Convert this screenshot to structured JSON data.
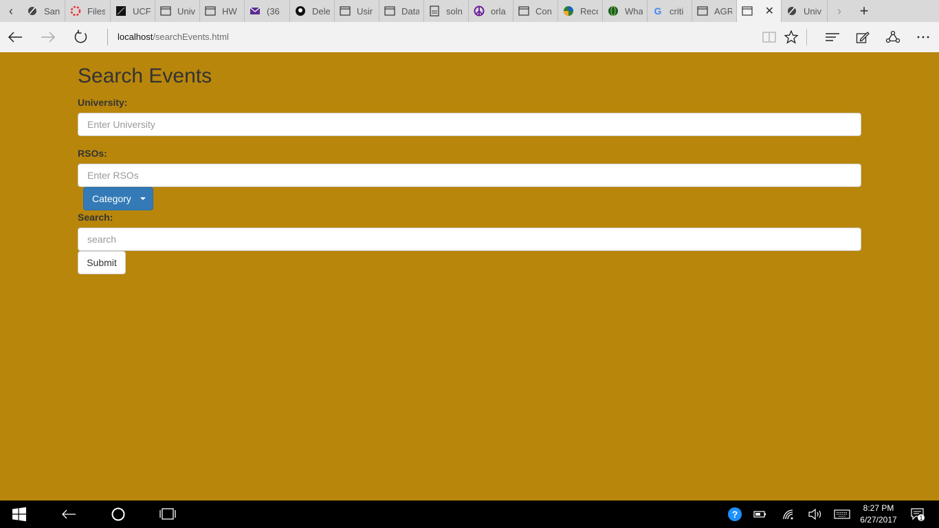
{
  "tabs": [
    {
      "label": "San",
      "icon": "unicorn-icon"
    },
    {
      "label": "Files",
      "icon": "lifering-icon"
    },
    {
      "label": "UCF",
      "icon": "ucf-icon"
    },
    {
      "label": "Univ",
      "icon": "page-icon"
    },
    {
      "label": "HW",
      "icon": "page-icon"
    },
    {
      "label": "(36",
      "icon": "mail-icon"
    },
    {
      "label": "Dele",
      "icon": "github-icon"
    },
    {
      "label": "Usir",
      "icon": "page-icon"
    },
    {
      "label": "Data",
      "icon": "page-icon"
    },
    {
      "label": "soln",
      "icon": "pdf-icon"
    },
    {
      "label": "orla",
      "icon": "peace-icon"
    },
    {
      "label": "Con",
      "icon": "page-icon"
    },
    {
      "label": "Reco",
      "icon": "globe-color-icon"
    },
    {
      "label": "Wha",
      "icon": "globe-icon"
    },
    {
      "label": "criti",
      "icon": "google-icon"
    },
    {
      "label": "AGR",
      "icon": "page-icon"
    },
    {
      "label": "",
      "icon": "page-icon",
      "active": true
    },
    {
      "label": "Univ",
      "icon": "unicorn-icon"
    }
  ],
  "address": {
    "host": "localhost",
    "path": "/searchEvents.html"
  },
  "page": {
    "title": "Search Events",
    "university_label": "University:",
    "university_placeholder": "Enter University",
    "rsos_label": "RSOs:",
    "rsos_placeholder": "Enter RSOs",
    "category_label": "Category",
    "search_label": "Search:",
    "search_placeholder": "search",
    "submit_label": "Submit"
  },
  "taskbar": {
    "time": "8:27 PM",
    "date": "6/27/2017",
    "notification_count": "1"
  },
  "colors": {
    "page_bg": "#b8860b",
    "primary_button": "#337ab7"
  }
}
